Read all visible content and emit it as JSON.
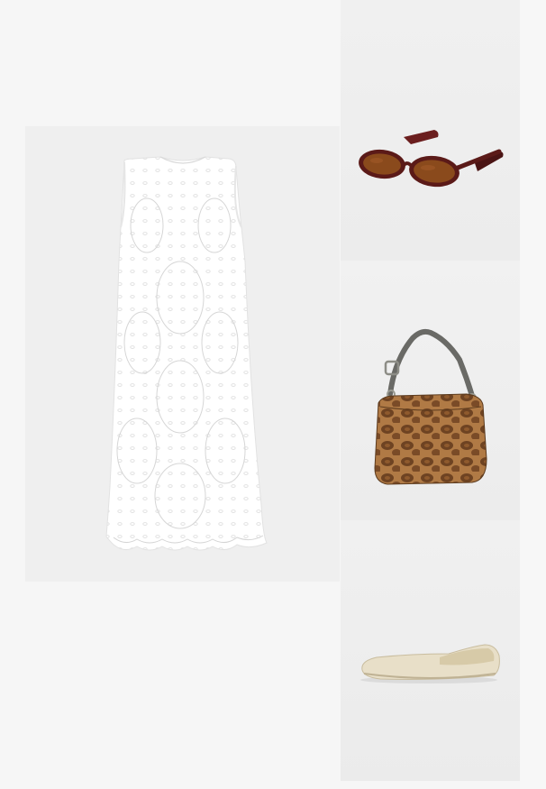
{
  "collage": {
    "items": [
      {
        "id": "dress",
        "icon": "white-eyelet-sleeveless-dress"
      },
      {
        "id": "sunglasses",
        "icon": "oval-brown-sunglasses"
      },
      {
        "id": "bag",
        "icon": "snakeskin-shoulder-bag"
      },
      {
        "id": "flats",
        "icon": "cream-ballet-flat"
      }
    ]
  }
}
